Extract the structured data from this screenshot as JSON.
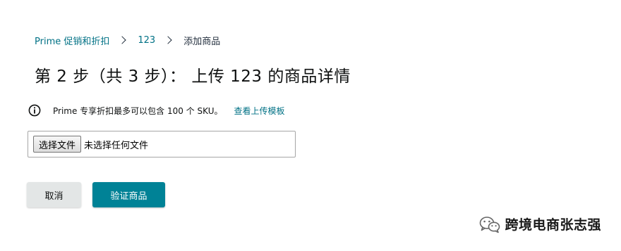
{
  "breadcrumb": {
    "items": [
      "Prime 促销和折扣",
      "123",
      "添加商品"
    ]
  },
  "page_title": "第 2 步（共 3 步）： 上传 123 的商品详情",
  "info": {
    "icon": "info-icon",
    "text": "Prime 专享折扣最多可以包含 100 个 SKU。",
    "link": "查看上传模板"
  },
  "file_upload": {
    "button_label": "选择文件",
    "status": "未选择任何文件"
  },
  "actions": {
    "cancel_label": "取消",
    "verify_label": "验证商品"
  },
  "watermark": {
    "text": "跨境电商张志强",
    "icon": "wechat-logo-icon"
  },
  "colors": {
    "link": "#007185",
    "primary_button": "#008296",
    "secondary_button": "#e3e6e6"
  }
}
